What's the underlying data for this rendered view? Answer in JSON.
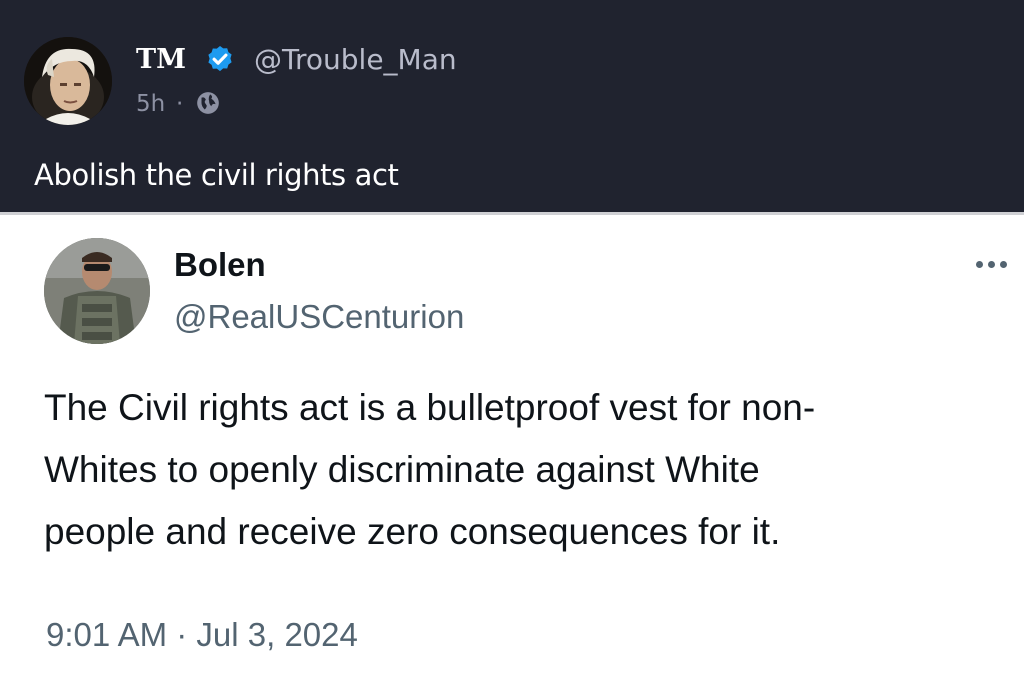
{
  "outer_post": {
    "author_name": "TM",
    "author_handle": "@Trouble_Man",
    "age": "5h",
    "separator": "·",
    "text": "Abolish the civil rights act",
    "icons": {
      "verified": "verified-badge-icon",
      "audience": "globe-icon"
    },
    "colors": {
      "background": "#20232f",
      "verified": "#1d9bf0"
    }
  },
  "quoted_tweet": {
    "author_name": "Bolen",
    "author_handle": "@RealUSCenturion",
    "text_lines": [
      "The Civil rights act is a bulletproof vest for non-",
      "Whites to openly discriminate against White",
      "people and receive zero consequences for it."
    ],
    "timestamp": "9:01 AM · Jul 3, 2024",
    "icons": {
      "more": "more-options-icon"
    }
  }
}
